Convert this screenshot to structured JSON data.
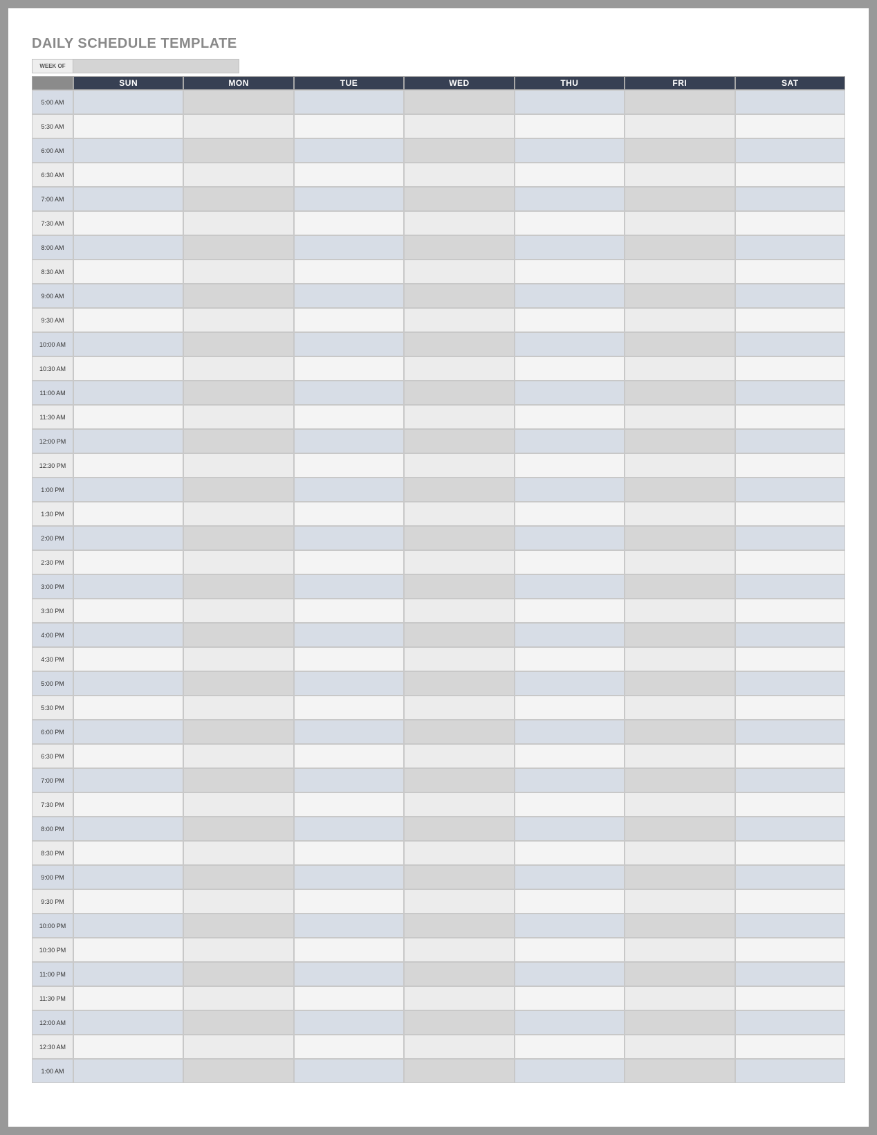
{
  "title": "DAILY SCHEDULE TEMPLATE",
  "weekof": {
    "label": "WEEK OF",
    "value": ""
  },
  "days": [
    "SUN",
    "MON",
    "TUE",
    "WED",
    "THU",
    "FRI",
    "SAT"
  ],
  "times": [
    "5:00 AM",
    "5:30 AM",
    "6:00 AM",
    "6:30 AM",
    "7:00 AM",
    "7:30 AM",
    "8:00 AM",
    "8:30 AM",
    "9:00 AM",
    "9:30 AM",
    "10:00 AM",
    "10:30 AM",
    "11:00 AM",
    "11:30 AM",
    "12:00 PM",
    "12:30 PM",
    "1:00 PM",
    "1:30 PM",
    "2:00 PM",
    "2:30 PM",
    "3:00 PM",
    "3:30 PM",
    "4:00 PM",
    "4:30 PM",
    "5:00 PM",
    "5:30 PM",
    "6:00 PM",
    "6:30 PM",
    "7:00 PM",
    "7:30 PM",
    "8:00 PM",
    "8:30 PM",
    "9:00 PM",
    "9:30 PM",
    "10:00 PM",
    "10:30 PM",
    "11:00 PM",
    "11:30 PM",
    "12:00 AM",
    "12:30 AM",
    "1:00 AM"
  ],
  "colors": {
    "header_bg": "#374053",
    "header_text": "#ffffff",
    "time_header_bg": "#8b8b8b",
    "band_a_time": "#d6dce6",
    "band_b_time": "#ececec"
  }
}
